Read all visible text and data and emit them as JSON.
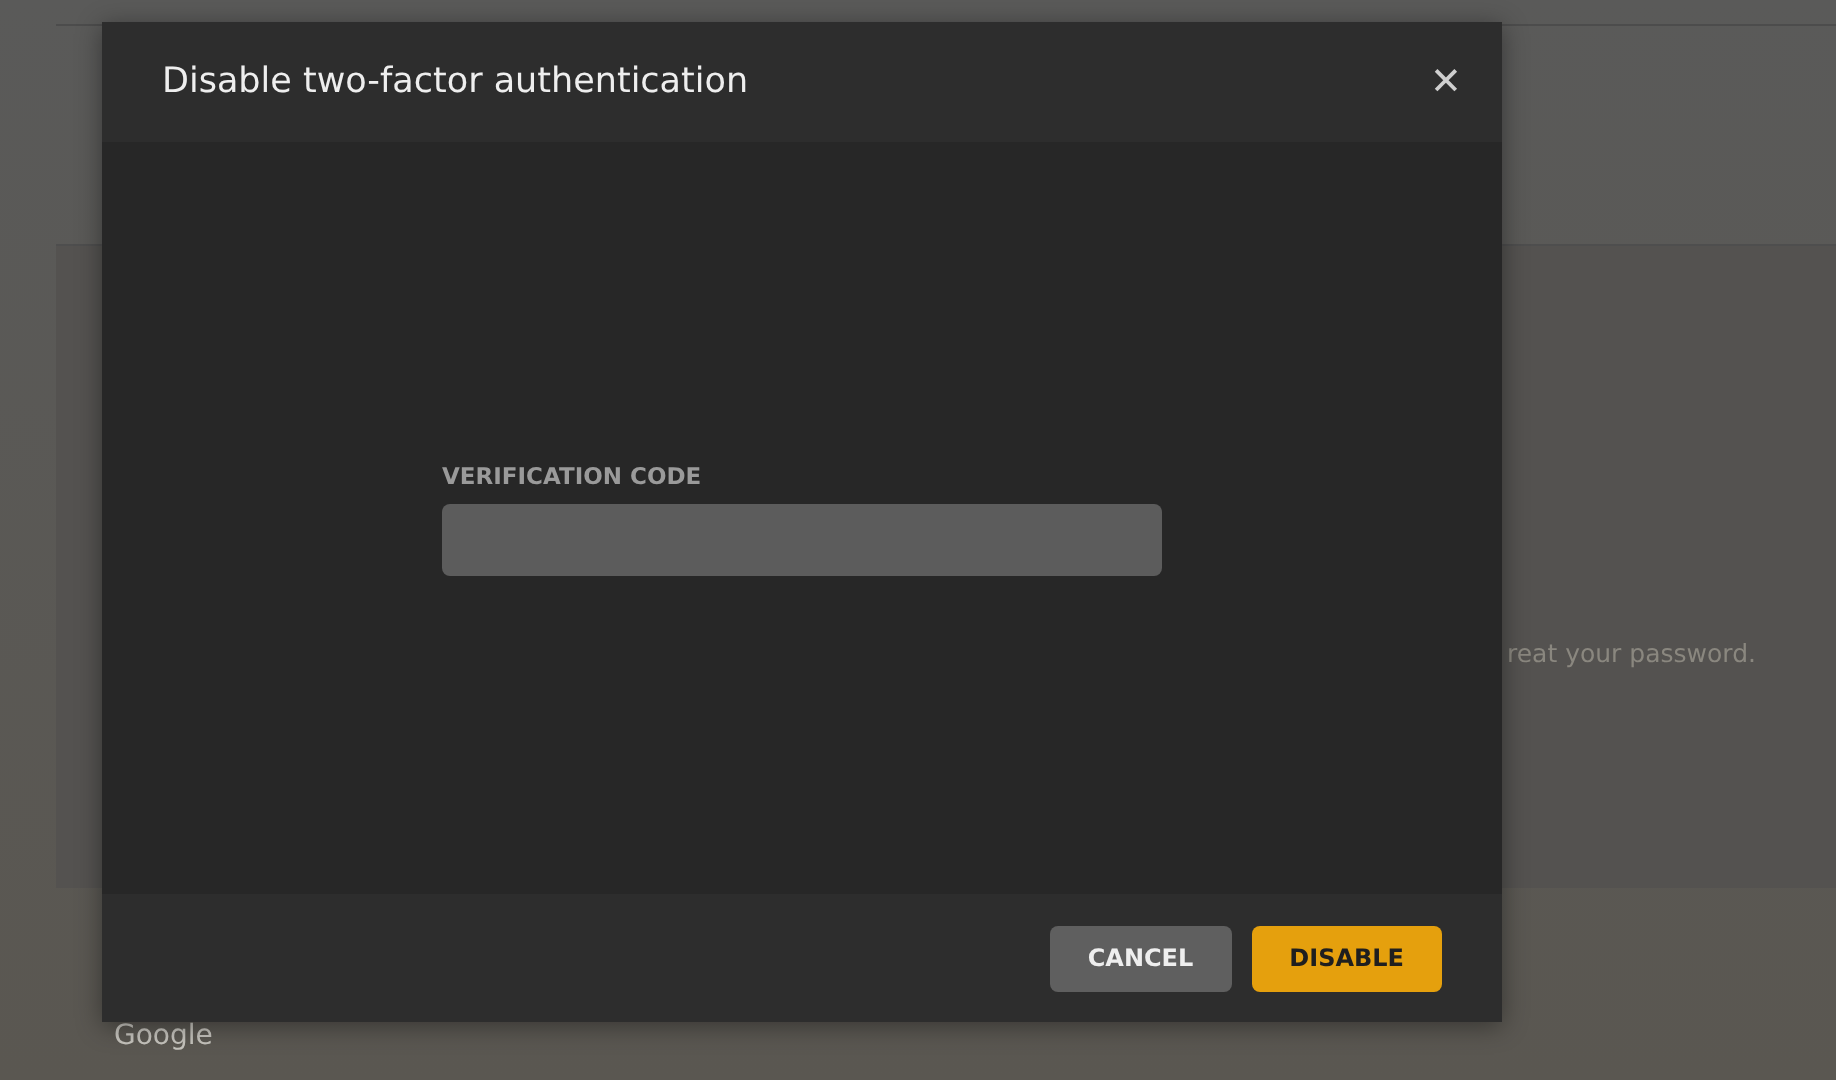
{
  "background": {
    "card_text": "reat your password.",
    "footer_text": "Google"
  },
  "dialog": {
    "title": "Disable two-factor authentication",
    "close": "✕",
    "field": {
      "label": "VERIFICATION CODE"
    },
    "buttons": [
      {
        "label": "CANCEL",
        "kind": "secondary"
      },
      {
        "label": "DISABLE",
        "kind": "primary"
      }
    ]
  }
}
